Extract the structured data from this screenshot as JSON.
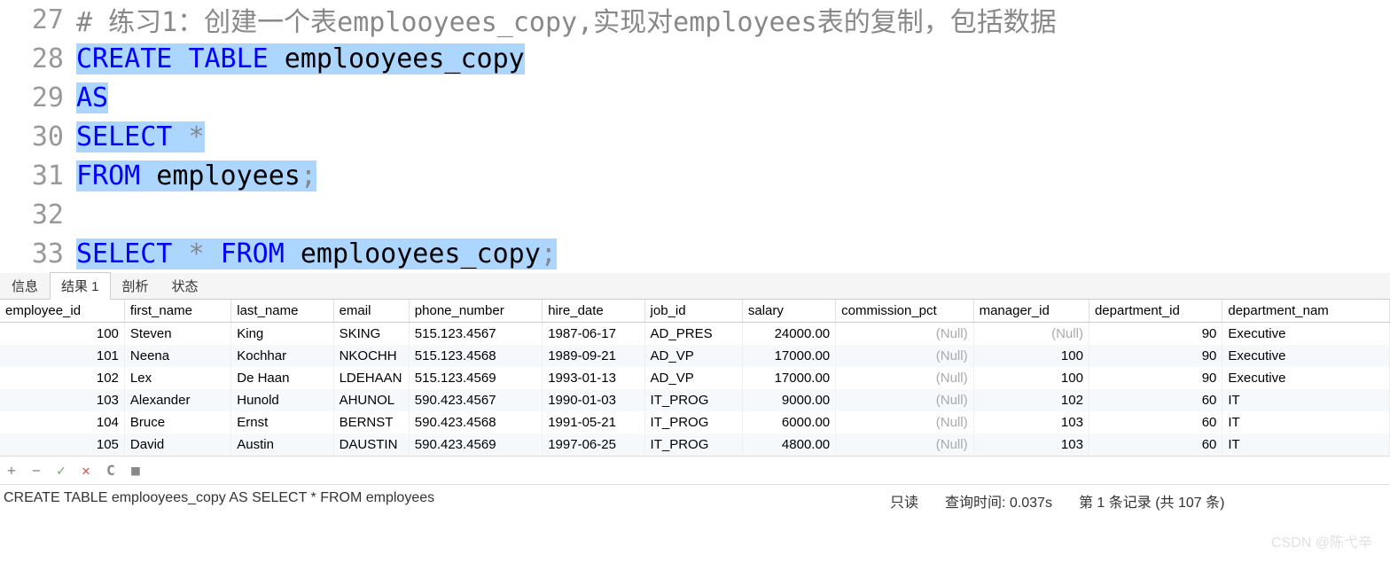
{
  "editor": {
    "lines": [
      {
        "num": "27",
        "segments": [
          {
            "t": "# 练习1：创建一个表emplooyees_copy,实现对employees表的复制，包括数据",
            "cls": "comment",
            "sel": false
          }
        ]
      },
      {
        "num": "28",
        "segments": [
          {
            "t": "CREATE",
            "cls": "kw",
            "sel": true
          },
          {
            "t": " ",
            "cls": "",
            "sel": true
          },
          {
            "t": "TABLE",
            "cls": "kw",
            "sel": true
          },
          {
            "t": " emplooyees_copy",
            "cls": "",
            "sel": true
          }
        ]
      },
      {
        "num": "29",
        "segments": [
          {
            "t": "AS",
            "cls": "kw",
            "sel": true
          }
        ]
      },
      {
        "num": "30",
        "segments": [
          {
            "t": "SELECT",
            "cls": "kw",
            "sel": true
          },
          {
            "t": " ",
            "cls": "",
            "sel": true
          },
          {
            "t": "*",
            "cls": "op",
            "sel": true
          }
        ]
      },
      {
        "num": "31",
        "segments": [
          {
            "t": "FROM",
            "cls": "kw",
            "sel": true
          },
          {
            "t": " employees",
            "cls": "",
            "sel": true
          },
          {
            "t": ";",
            "cls": "op",
            "sel": true
          }
        ]
      },
      {
        "num": "32",
        "segments": [
          {
            "t": "",
            "cls": "",
            "sel": true
          }
        ]
      },
      {
        "num": "33",
        "segments": [
          {
            "t": "SELECT",
            "cls": "kw",
            "sel": true
          },
          {
            "t": " ",
            "cls": "",
            "sel": true
          },
          {
            "t": "*",
            "cls": "op",
            "sel": true
          },
          {
            "t": " ",
            "cls": "",
            "sel": true
          },
          {
            "t": "FROM",
            "cls": "kw",
            "sel": true
          },
          {
            "t": " emplooyees_copy",
            "cls": "",
            "sel": true
          },
          {
            "t": ";",
            "cls": "op",
            "sel": true
          }
        ]
      }
    ]
  },
  "tabs": {
    "items": [
      "信息",
      "结果 1",
      "剖析",
      "状态"
    ],
    "active": 1
  },
  "columns": [
    {
      "name": "employee_id",
      "w": 140,
      "align": "num"
    },
    {
      "name": "first_name",
      "w": 120,
      "align": ""
    },
    {
      "name": "last_name",
      "w": 115,
      "align": ""
    },
    {
      "name": "email",
      "w": 85,
      "align": ""
    },
    {
      "name": "phone_number",
      "w": 150,
      "align": ""
    },
    {
      "name": "hire_date",
      "w": 115,
      "align": ""
    },
    {
      "name": "job_id",
      "w": 110,
      "align": ""
    },
    {
      "name": "salary",
      "w": 105,
      "align": "num"
    },
    {
      "name": "commission_pct",
      "w": 155,
      "align": "num"
    },
    {
      "name": "manager_id",
      "w": 130,
      "align": "num"
    },
    {
      "name": "department_id",
      "w": 150,
      "align": "num"
    },
    {
      "name": "department_nam",
      "w": 188,
      "align": ""
    }
  ],
  "rows": [
    {
      "employee_id": "100",
      "first_name": "Steven",
      "last_name": "King",
      "email": "SKING",
      "phone_number": "515.123.4567",
      "hire_date": "1987-06-17",
      "job_id": "AD_PRES",
      "salary": "24000.00",
      "commission_pct": null,
      "manager_id": null,
      "department_id": "90",
      "department_nam": "Executive"
    },
    {
      "employee_id": "101",
      "first_name": "Neena",
      "last_name": "Kochhar",
      "email": "NKOCHH",
      "phone_number": "515.123.4568",
      "hire_date": "1989-09-21",
      "job_id": "AD_VP",
      "salary": "17000.00",
      "commission_pct": null,
      "manager_id": "100",
      "department_id": "90",
      "department_nam": "Executive"
    },
    {
      "employee_id": "102",
      "first_name": "Lex",
      "last_name": "De Haan",
      "email": "LDEHAAN",
      "phone_number": "515.123.4569",
      "hire_date": "1993-01-13",
      "job_id": "AD_VP",
      "salary": "17000.00",
      "commission_pct": null,
      "manager_id": "100",
      "department_id": "90",
      "department_nam": "Executive"
    },
    {
      "employee_id": "103",
      "first_name": "Alexander",
      "last_name": "Hunold",
      "email": "AHUNOL",
      "phone_number": "590.423.4567",
      "hire_date": "1990-01-03",
      "job_id": "IT_PROG",
      "salary": "9000.00",
      "commission_pct": null,
      "manager_id": "102",
      "department_id": "60",
      "department_nam": "IT"
    },
    {
      "employee_id": "104",
      "first_name": "Bruce",
      "last_name": "Ernst",
      "email": "BERNST",
      "phone_number": "590.423.4568",
      "hire_date": "1991-05-21",
      "job_id": "IT_PROG",
      "salary": "6000.00",
      "commission_pct": null,
      "manager_id": "103",
      "department_id": "60",
      "department_nam": "IT"
    },
    {
      "employee_id": "105",
      "first_name": "David",
      "last_name": "Austin",
      "email": "DAUSTIN",
      "phone_number": "590.423.4569",
      "hire_date": "1997-06-25",
      "job_id": "IT_PROG",
      "salary": "4800.00",
      "commission_pct": null,
      "manager_id": "103",
      "department_id": "60",
      "department_nam": "IT"
    }
  ],
  "null_label": "(Null)",
  "toolbar": {
    "add": "+",
    "remove": "−",
    "apply": "✓",
    "cancel": "✕",
    "refresh": "C",
    "stop": "■"
  },
  "status": {
    "sql": "CREATE TABLE emplooyees_copy AS SELECT * FROM employees",
    "readonly": "只读",
    "query_time": "查询时间: 0.037s",
    "record": "第 1 条记录 (共 107 条)"
  },
  "watermark": "CSDN @陈弋辛"
}
